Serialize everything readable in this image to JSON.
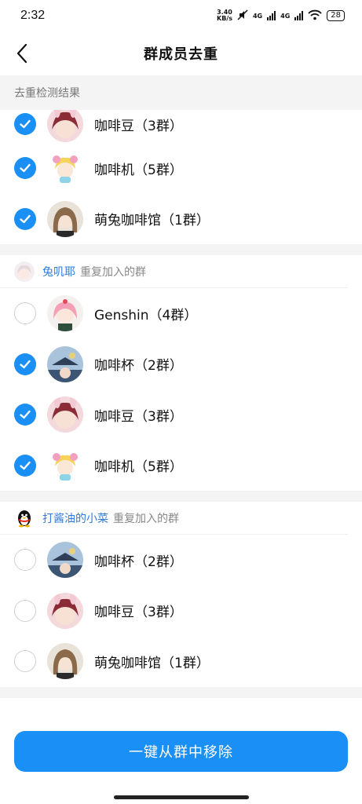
{
  "status": {
    "time": "2:32",
    "speed_top": "3.40",
    "speed_bottom": "KB/s",
    "net1": "4G",
    "net2": "4G",
    "battery": "28"
  },
  "nav": {
    "title": "群成员去重"
  },
  "section": {
    "title": "去重检测结果"
  },
  "group0": {
    "rows": [
      {
        "label": "咖啡豆（3群）",
        "checked": true
      },
      {
        "label": "咖啡机（5群）",
        "checked": true
      },
      {
        "label": "萌兔咖啡馆（1群）",
        "checked": true
      }
    ]
  },
  "group1": {
    "name": "兔叽耶",
    "desc": "重复加入的群",
    "rows": [
      {
        "label": "Genshin（4群）",
        "checked": false
      },
      {
        "label": "咖啡杯（2群）",
        "checked": true
      },
      {
        "label": "咖啡豆（3群）",
        "checked": true
      },
      {
        "label": "咖啡机（5群）",
        "checked": true
      }
    ]
  },
  "group2": {
    "name": "打酱油的小菜",
    "desc": "重复加入的群",
    "rows": [
      {
        "label": "咖啡杯（2群）",
        "checked": false
      },
      {
        "label": "咖啡豆（3群）",
        "checked": false
      },
      {
        "label": "萌兔咖啡馆（1群）",
        "checked": false
      }
    ]
  },
  "footer": {
    "button": "一键从群中移除"
  },
  "colors": {
    "accent": "#1a8ff5",
    "link": "#2e7bd8"
  }
}
